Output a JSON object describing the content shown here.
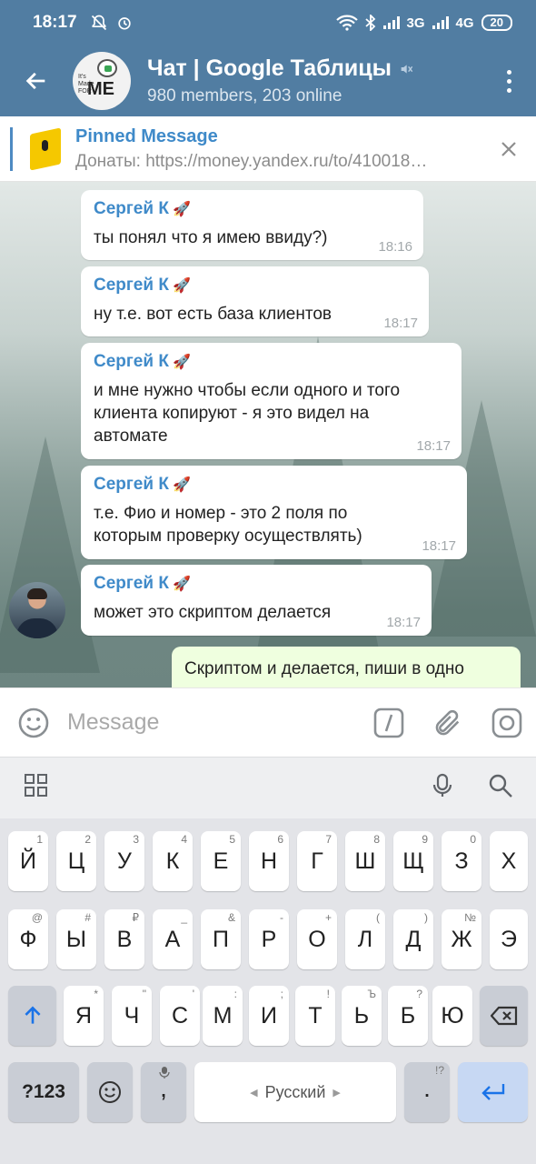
{
  "status_bar": {
    "time": "18:17",
    "net3g": "3G",
    "net4g": "4G",
    "net4g_sub": ".ıl",
    "battery": "20"
  },
  "header": {
    "title": "Чат | Google Таблицы",
    "subtitle": "980 members, 203 online",
    "avatar_text_small": "It's Made FOR",
    "avatar_text_big": "ME"
  },
  "pinned": {
    "title": "Pinned Message",
    "body": "Донаты: https://money.yandex.ru/to/410018…"
  },
  "messages": [
    {
      "sender": "Сергей К",
      "text": "ты понял что я имею ввиду?)",
      "time": "18:16"
    },
    {
      "sender": "Сергей К",
      "text": "ну т.е. вот есть база клиентов",
      "time": "18:17"
    },
    {
      "sender": "Сергей К",
      "text": "и мне нужно чтобы если одного и того клиента копируют - я это видел на автомате",
      "time": "18:17"
    },
    {
      "sender": "Сергей К",
      "text": "т.е. Фио и номер - это 2 поля по которым проверку осуществлять)",
      "time": "18:17"
    },
    {
      "sender": "Сергей К",
      "text": "может это скриптом делается",
      "time": "18:17"
    },
    {
      "sender": "",
      "text": "Скриптом и делается, пиши в одно",
      "time": ""
    }
  ],
  "composer": {
    "placeholder": "Message"
  },
  "keyboard": {
    "row1": [
      [
        "Й",
        "1"
      ],
      [
        "Ц",
        "2"
      ],
      [
        "У",
        "3"
      ],
      [
        "К",
        "4"
      ],
      [
        "Е",
        "5"
      ],
      [
        "Н",
        "6"
      ],
      [
        "Г",
        "7"
      ],
      [
        "Ш",
        "8"
      ],
      [
        "Щ",
        "9"
      ],
      [
        "З",
        "0"
      ],
      [
        "Х",
        ""
      ]
    ],
    "row2": [
      [
        "Ф",
        "@"
      ],
      [
        "Ы",
        "#"
      ],
      [
        "В",
        "₽"
      ],
      [
        "А",
        "_"
      ],
      [
        "П",
        "&"
      ],
      [
        "Р",
        "-"
      ],
      [
        "О",
        "+"
      ],
      [
        "Л",
        "("
      ],
      [
        "Д",
        ")"
      ],
      [
        "Ж",
        "№"
      ],
      [
        "Э",
        ""
      ]
    ],
    "row3": [
      [
        "Я",
        "*"
      ],
      [
        "Ч",
        "\""
      ],
      [
        "С",
        "'"
      ],
      [
        "М",
        ":"
      ],
      [
        "И",
        ";"
      ],
      [
        "Т",
        "!"
      ],
      [
        "Ь",
        "Ъ"
      ],
      [
        "Б",
        "?"
      ],
      [
        "Ю",
        ""
      ]
    ],
    "sym_label": "?123",
    "comma": ",",
    "space_label": "Русский",
    "period": ".",
    "period_hint": "!?"
  },
  "colors": {
    "header": "#517DA2",
    "link": "#3f8ac9",
    "outgoing": "#efffdf",
    "keyboard_bg": "#e3e4e8"
  },
  "icons": [
    "arrow-back-icon",
    "mute-icon",
    "more-vert-icon",
    "close-icon",
    "emoji-icon",
    "slash-command-icon",
    "attach-icon",
    "camera-icon",
    "grid-icon",
    "mic-icon",
    "search-icon",
    "shift-icon",
    "backspace-icon",
    "enter-icon"
  ]
}
